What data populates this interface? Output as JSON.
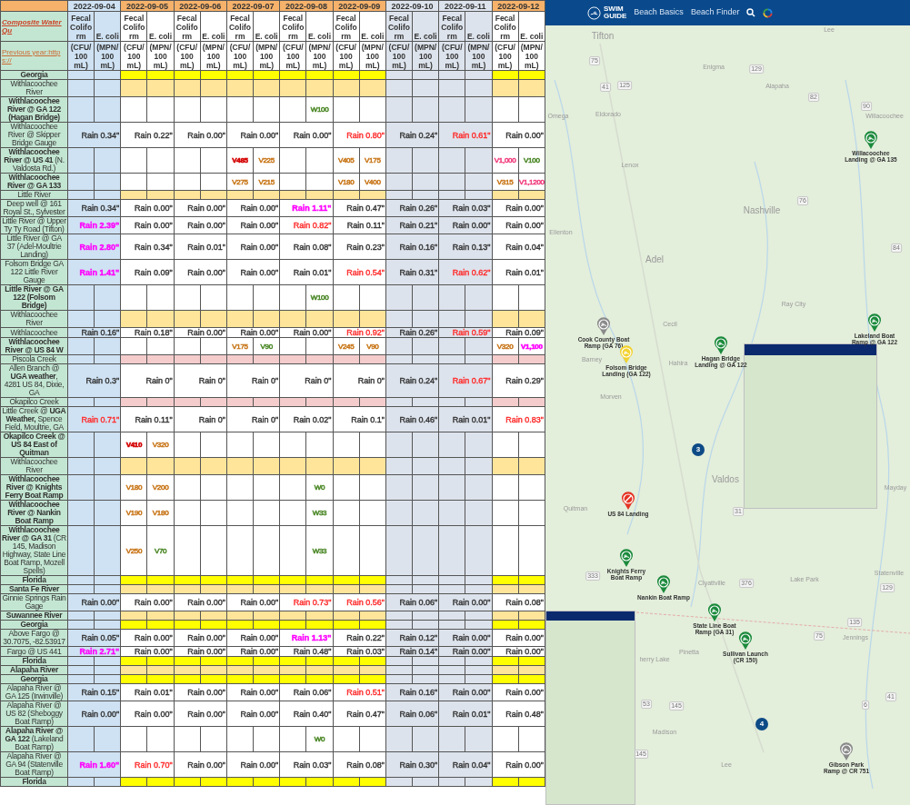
{
  "table": {
    "title": "Composite Water Qu",
    "previous_year": "Previous year:https://",
    "dates": [
      {
        "date": "2022-09-04",
        "kind": "shaded",
        "color": "#cfe2f3",
        "measures": [
          "Fecal Coliform",
          "E. coli"
        ],
        "units": [
          "(CFU/ 100 mL)",
          "(MPN/ 100 mL)"
        ]
      },
      {
        "date": "2022-09-05",
        "kind": "plain",
        "measures": [
          "Fecal Coliform",
          "E. coli"
        ],
        "units": [
          "(CFU/ 100 mL)",
          "(MPN/ 100 mL)"
        ]
      },
      {
        "date": "2022-09-06",
        "kind": "plain",
        "measures": [
          "Fecal Coliform",
          "E. coli"
        ],
        "units": [
          "(CFU/ 100 mL)",
          "(MPN/ 100 mL)"
        ]
      },
      {
        "date": "2022-09-07",
        "kind": "plain",
        "measures": [
          "Fecal Coliform",
          "E. coli"
        ],
        "units": [
          "(CFU/ 100 mL)",
          "(MPN/ 100 mL)"
        ]
      },
      {
        "date": "2022-09-08",
        "kind": "plain",
        "measures": [
          "Fecal Coliform",
          "E. coli"
        ],
        "units": [
          "(CFU/ 100 mL)",
          "(MPN/ 100 mL)"
        ]
      },
      {
        "date": "2022-09-09",
        "kind": "plain",
        "measures": [
          "Fecal Coliform",
          "E. coli"
        ],
        "units": [
          "(CFU/ 100 mL)",
          "(MPN/ 100 mL)"
        ]
      },
      {
        "date": "2022-09-10",
        "kind": "shaded",
        "color": "#dde3ec",
        "measures": [
          "Fecal Coliform",
          "E. coli"
        ],
        "units": [
          "(CFU/ 100 mL)",
          "(MPN/ 100 mL)"
        ]
      },
      {
        "date": "2022-09-11",
        "kind": "shaded",
        "color": "#dde3ec",
        "measures": [
          "Fecal Coliform",
          "E. coli"
        ],
        "units": [
          "(CFU/ 100 mL)",
          "(MPN/ 100 mL)"
        ]
      },
      {
        "date": "2022-09-12",
        "kind": "plain",
        "measures": [
          "Fecal Coliform",
          "E. coli"
        ],
        "units": [
          "(CFU/ 100 mL)",
          "(MPN/ 100 mL)"
        ]
      }
    ],
    "rows": [
      {
        "kind": "state",
        "label": "Georgia",
        "bold": true
      },
      {
        "kind": "river",
        "label": "Withlacoochee River",
        "bold": false
      },
      {
        "kind": "site",
        "label": "Withlacoochee River @ GA 122 (Hagan Bridge)",
        "bold": true,
        "cells": [
          null,
          null,
          null,
          null,
          {
            "ecoli": {
              "text": "W100",
              "color": "#4f8a2b",
              "bold": false
            }
          },
          null,
          null,
          null,
          null
        ]
      },
      {
        "kind": "site",
        "label": "Withlacoochee River @ Skipper Bridge Gauge",
        "bold": false,
        "cells": [
          {
            "rain": "Rain 0.34\"",
            "color": "#333333",
            "bold": false
          },
          {
            "rain": "Rain 0.22\"",
            "color": "#333333",
            "bold": false
          },
          {
            "rain": "Rain 0.00\"",
            "color": "#333333",
            "bold": false
          },
          {
            "rain": "Rain 0.00\"",
            "color": "#333333",
            "bold": false
          },
          {
            "rain": "Rain 0.00\"",
            "color": "#333333",
            "bold": false
          },
          {
            "rain": "Rain 0.80\"",
            "color": "#ff2a2a",
            "bold": false
          },
          {
            "rain": "Rain 0.24\"",
            "color": "#333333",
            "bold": false
          },
          {
            "rain": "Rain 0.61\"",
            "color": "#ff2a2a",
            "bold": false
          },
          {
            "rain": "Rain 0.00\"",
            "color": "#333333",
            "bold": false
          }
        ]
      },
      {
        "kind": "site",
        "label": "**Withlacoochee River @ US 41** (N. Valdosta Rd.)",
        "bold": false,
        "cells": [
          null,
          null,
          null,
          {
            "fecal": {
              "text": "V485",
              "color": "#d40000",
              "bold": true
            },
            "ecoli": {
              "text": "V225",
              "color": "#c9781c",
              "bold": false
            }
          },
          null,
          {
            "fecal": {
              "text": "V405",
              "color": "#c9781c",
              "bold": false
            },
            "ecoli": {
              "text": "V175",
              "color": "#c9781c",
              "bold": false
            }
          },
          null,
          null,
          {
            "fecal": {
              "text": "V1,000",
              "color": "#f0407f",
              "bold": false
            },
            "ecoli": {
              "text": "V100",
              "color": "#4f8a2b",
              "bold": false
            }
          }
        ]
      },
      {
        "kind": "site",
        "label": "Withlacoochee River @ GA 133",
        "bold": true,
        "cells": [
          null,
          null,
          null,
          {
            "fecal": {
              "text": "V275",
              "color": "#c9781c",
              "bold": false
            },
            "ecoli": {
              "text": "V215",
              "color": "#c9781c",
              "bold": false
            }
          },
          null,
          {
            "fecal": {
              "text": "V180",
              "color": "#c9781c",
              "bold": false
            },
            "ecoli": {
              "text": "V400",
              "color": "#c9781c",
              "bold": false
            }
          },
          null,
          null,
          {
            "fecal": {
              "text": "V315",
              "color": "#c9781c",
              "bold": false
            },
            "ecoli": {
              "text": "V1,1200",
              "color": "#f0407f",
              "bold": false
            }
          }
        ]
      },
      {
        "kind": "river",
        "label": "Little River",
        "bold": false
      },
      {
        "kind": "site",
        "label": "Deep well @ 161 Royal St., Sylvester",
        "bold": false,
        "cells": [
          {
            "rain": "Rain 0.34\"",
            "color": "#333333",
            "bold": false
          },
          {
            "rain": "Rain 0.00\"",
            "color": "#333333",
            "bold": false
          },
          {
            "rain": "Rain 0.00\"",
            "color": "#333333",
            "bold": false
          },
          {
            "rain": "Rain 0.00\"",
            "color": "#333333",
            "bold": false
          },
          {
            "rain": "Rain 1.11\"",
            "color": "#ff00ff",
            "bold": true
          },
          {
            "rain": "Rain 0.47\"",
            "color": "#333333",
            "bold": false
          },
          {
            "rain": "Rain 0.26\"",
            "color": "#333333",
            "bold": false
          },
          {
            "rain": "Rain 0.03\"",
            "color": "#333333",
            "bold": false
          },
          {
            "rain": "Rain 0.00\"",
            "color": "#333333",
            "bold": false
          }
        ]
      },
      {
        "kind": "site",
        "label": "Little River @ Upper Ty Ty Road (Tifton)",
        "bold": false,
        "cells": [
          {
            "rain": "Rain 2.39\"",
            "color": "#ff00ff",
            "bold": true
          },
          {
            "rain": "Rain 0.00\"",
            "color": "#333333",
            "bold": false
          },
          {
            "rain": "Rain 0.00\"",
            "color": "#333333",
            "bold": false
          },
          {
            "rain": "Rain 0.00\"",
            "color": "#333333",
            "bold": false
          },
          {
            "rain": "Rain 0.82\"",
            "color": "#ff2a2a",
            "bold": false
          },
          {
            "rain": "Rain 0.11\"",
            "color": "#333333",
            "bold": false
          },
          {
            "rain": "Rain 0.21\"",
            "color": "#333333",
            "bold": false
          },
          {
            "rain": "Rain 0.00\"",
            "color": "#333333",
            "bold": false
          },
          {
            "rain": "Rain 0.00\"",
            "color": "#333333",
            "bold": false
          }
        ]
      },
      {
        "kind": "site",
        "label": "Little River @ GA 37 (Adel-Moultrie Landing)",
        "bold": false,
        "cells": [
          {
            "rain": "Rain 2.80\"",
            "color": "#ff00ff",
            "bold": true
          },
          {
            "rain": "Rain 0.34\"",
            "color": "#333333",
            "bold": false
          },
          {
            "rain": "Rain 0.01\"",
            "color": "#333333",
            "bold": false
          },
          {
            "rain": "Rain 0.00\"",
            "color": "#333333",
            "bold": false
          },
          {
            "rain": "Rain 0.08\"",
            "color": "#333333",
            "bold": false
          },
          {
            "rain": "Rain 0.23\"",
            "color": "#333333",
            "bold": false
          },
          {
            "rain": "Rain 0.16\"",
            "color": "#333333",
            "bold": false
          },
          {
            "rain": "Rain 0.13\"",
            "color": "#333333",
            "bold": false
          },
          {
            "rain": "Rain 0.04\"",
            "color": "#333333",
            "bold": false
          }
        ]
      },
      {
        "kind": "site",
        "label": "Folsom Bridge GA 122 Little River Gauge",
        "bold": false,
        "cells": [
          {
            "rain": "Rain 1.41\"",
            "color": "#ff00ff",
            "bold": true
          },
          {
            "rain": "Rain 0.09\"",
            "color": "#333333",
            "bold": false
          },
          {
            "rain": "Rain 0.00\"",
            "color": "#333333",
            "bold": false
          },
          {
            "rain": "Rain 0.00\"",
            "color": "#333333",
            "bold": false
          },
          {
            "rain": "Rain 0.01\"",
            "color": "#333333",
            "bold": false
          },
          {
            "rain": "Rain 0.54\"",
            "color": "#ff2a2a",
            "bold": false
          },
          {
            "rain": "Rain 0.31\"",
            "color": "#333333",
            "bold": false
          },
          {
            "rain": "Rain 0.62\"",
            "color": "#ff2a2a",
            "bold": false
          },
          {
            "rain": "Rain 0.01\"",
            "color": "#333333",
            "bold": false
          }
        ]
      },
      {
        "kind": "site",
        "label": "Little River @ GA 122 (Folsom Bridge)",
        "bold": true,
        "cells": [
          null,
          null,
          null,
          null,
          {
            "ecoli": {
              "text": "W100",
              "color": "#4f8a2b",
              "bold": false
            }
          },
          null,
          null,
          null,
          null
        ]
      },
      {
        "kind": "river",
        "label": "Withlacoochee River",
        "bold": false
      },
      {
        "kind": "site",
        "label": "Withlacoochee",
        "bold": false,
        "cells": [
          {
            "rain": "Rain 0.16\"",
            "color": "#333333",
            "bold": false
          },
          {
            "rain": "Rain 0.18\"",
            "color": "#333333",
            "bold": false
          },
          {
            "rain": "Rain 0.00\"",
            "color": "#333333",
            "bold": false
          },
          {
            "rain": "Rain 0.00\"",
            "color": "#333333",
            "bold": false
          },
          {
            "rain": "Rain 0.00\"",
            "color": "#333333",
            "bold": false
          },
          {
            "rain": "Rain 0.92\"",
            "color": "#ff2a2a",
            "bold": false
          },
          {
            "rain": "Rain 0.26\"",
            "color": "#333333",
            "bold": false
          },
          {
            "rain": "Rain 0.59\"",
            "color": "#ff2a2a",
            "bold": false
          },
          {
            "rain": "Rain 0.09\"",
            "color": "#333333",
            "bold": false
          }
        ]
      },
      {
        "kind": "site",
        "label": "Withlacoochee River @ US 84 W",
        "bold": true,
        "cells": [
          null,
          null,
          null,
          {
            "fecal": {
              "text": "V175",
              "color": "#c9781c",
              "bold": false
            },
            "ecoli": {
              "text": "V90",
              "color": "#4f8a2b",
              "bold": false
            }
          },
          null,
          {
            "fecal": {
              "text": "V245",
              "color": "#c9781c",
              "bold": false
            },
            "ecoli": {
              "text": "V90",
              "color": "#c9781c",
              "bold": false
            }
          },
          null,
          null,
          {
            "fecal": {
              "text": "V320",
              "color": "#c9781c",
              "bold": false
            },
            "ecoli": {
              "text": "V1,100",
              "color": "#ff00ff",
              "bold": true
            }
          }
        ]
      },
      {
        "kind": "creek",
        "label": "Piscola Creek",
        "bold": false
      },
      {
        "kind": "site",
        "label": "Allen  Branch @ **UGA weather**, 4281 US 84, Dixie, GA",
        "bold": false,
        "cells": [
          {
            "rain": "Rain 0.3\"",
            "color": "#333333",
            "bold": false
          },
          {
            "rain": "Rain 0\"",
            "color": "#333333",
            "bold": false
          },
          {
            "rain": "Rain 0\"",
            "color": "#333333",
            "bold": false
          },
          {
            "rain": "Rain 0\"",
            "color": "#333333",
            "bold": false
          },
          {
            "rain": "Rain 0\"",
            "color": "#333333",
            "bold": false
          },
          {
            "rain": "Rain 0\"",
            "color": "#333333",
            "bold": false
          },
          {
            "rain": "Rain 0.24\"",
            "color": "#333333",
            "bold": false
          },
          {
            "rain": "Rain 0.67\"",
            "color": "#ff2a2a",
            "bold": false
          },
          {
            "rain": "Rain 0.29\"",
            "color": "#333333",
            "bold": false
          }
        ]
      },
      {
        "kind": "creek",
        "label": "Okapilco Creek",
        "bold": false
      },
      {
        "kind": "site",
        "label": "Little Creek @ **UGA Weather,** Spence Field, Moultrie, GA",
        "bold": false,
        "cells": [
          {
            "rain": "Rain 0.71\"",
            "color": "#ff2a2a",
            "bold": false
          },
          {
            "rain": "Rain 0.11\"",
            "color": "#333333",
            "bold": false
          },
          {
            "rain": "Rain 0\"",
            "color": "#333333",
            "bold": false
          },
          {
            "rain": "Rain 0\"",
            "color": "#333333",
            "bold": false
          },
          {
            "rain": "Rain 0.02\"",
            "color": "#333333",
            "bold": false
          },
          {
            "rain": "Rain 0.1\"",
            "color": "#333333",
            "bold": false
          },
          {
            "rain": "Rain 0.46\"",
            "color": "#333333",
            "bold": false
          },
          {
            "rain": "Rain 0.01\"",
            "color": "#333333",
            "bold": false
          },
          {
            "rain": "Rain 0.83\"",
            "color": "#ff2a2a",
            "bold": false
          }
        ]
      },
      {
        "kind": "site",
        "label": "Okapilco Creek @ US 84 East of Quitman",
        "bold": true,
        "cells": [
          null,
          {
            "fecal": {
              "text": "V410",
              "color": "#d40000",
              "bold": true
            },
            "ecoli": {
              "text": "V320",
              "color": "#c9781c",
              "bold": false
            }
          },
          null,
          null,
          null,
          null,
          null,
          null,
          null
        ]
      },
      {
        "kind": "river",
        "label": "Withlacoochee River",
        "bold": false
      },
      {
        "kind": "site",
        "label": "Withlacoochee River @ Knights Ferry Boat Ramp",
        "bold": true,
        "cells": [
          null,
          {
            "fecal": {
              "text": "V180",
              "color": "#c9781c",
              "bold": false
            },
            "ecoli": {
              "text": "V200",
              "color": "#c9781c",
              "bold": false
            }
          },
          null,
          null,
          {
            "ecoli": {
              "text": "W0",
              "color": "#4f8a2b",
              "bold": false
            }
          },
          null,
          null,
          null,
          null
        ]
      },
      {
        "kind": "site",
        "label": "Withlacoochee River @ Nankin Boat Ramp",
        "bold": true,
        "cells": [
          null,
          {
            "fecal": {
              "text": "V190",
              "color": "#c9781c",
              "bold": false
            },
            "ecoli": {
              "text": "V180",
              "color": "#c9781c",
              "bold": false
            }
          },
          null,
          null,
          {
            "ecoli": {
              "text": "W33",
              "color": "#4f8a2b",
              "bold": false
            }
          },
          null,
          null,
          null,
          null
        ]
      },
      {
        "kind": "site",
        "label": "**Withlacoochee River @ GA 31** (CR 145, Madison Highway, State Line Boat Ramp, Mozell Spells)",
        "bold": false,
        "cells": [
          null,
          {
            "fecal": {
              "text": "V250",
              "color": "#c9781c",
              "bold": false
            },
            "ecoli": {
              "text": "V70",
              "color": "#4f8a2b",
              "bold": false
            }
          },
          null,
          null,
          {
            "ecoli": {
              "text": "W33",
              "color": "#4f8a2b",
              "bold": false
            }
          },
          null,
          null,
          null,
          null
        ]
      },
      {
        "kind": "state",
        "label": "Florida",
        "bold": true
      },
      {
        "kind": "river",
        "label": "Santa Fe River",
        "bold": true
      },
      {
        "kind": "site",
        "label": "Ginnie Springs Rain Gage",
        "bold": false,
        "cells": [
          {
            "rain": "Rain 0.00\"",
            "color": "#333333",
            "bold": false
          },
          {
            "rain": "Rain 0.00\"",
            "color": "#333333",
            "bold": false
          },
          {
            "rain": "Rain 0.00\"",
            "color": "#333333",
            "bold": false
          },
          {
            "rain": "Rain 0.00\"",
            "color": "#333333",
            "bold": false
          },
          {
            "rain": "Rain 0.73\"",
            "color": "#ff2a2a",
            "bold": false
          },
          {
            "rain": "Rain 0.56\"",
            "color": "#ff2a2a",
            "bold": false
          },
          {
            "rain": "Rain 0.06\"",
            "color": "#333333",
            "bold": false
          },
          {
            "rain": "Rain 0.00\"",
            "color": "#333333",
            "bold": false
          },
          {
            "rain": "Rain 0.08\"",
            "color": "#333333",
            "bold": false
          }
        ]
      },
      {
        "kind": "river",
        "label": "Suwannee River",
        "bold": true
      },
      {
        "kind": "state",
        "label": "Georgia",
        "bold": true
      },
      {
        "kind": "site",
        "label": "Above Fargo @ 30.7075, -82.53917",
        "bold": false,
        "cells": [
          {
            "rain": "Rain 0.05\"",
            "color": "#333333",
            "bold": false
          },
          {
            "rain": "Rain 0.00\"",
            "color": "#333333",
            "bold": false
          },
          {
            "rain": "Rain 0.00\"",
            "color": "#333333",
            "bold": false
          },
          {
            "rain": "Rain 0.00\"",
            "color": "#333333",
            "bold": false
          },
          {
            "rain": "Rain 1.13\"",
            "color": "#ff00ff",
            "bold": true
          },
          {
            "rain": "Rain 0.22\"",
            "color": "#333333",
            "bold": false
          },
          {
            "rain": "Rain 0.12\"",
            "color": "#333333",
            "bold": false
          },
          {
            "rain": "Rain 0.00\"",
            "color": "#333333",
            "bold": false
          },
          {
            "rain": "Rain 0.00\"",
            "color": "#333333",
            "bold": false
          }
        ]
      },
      {
        "kind": "site",
        "label": "Fargo @ US 441",
        "bold": false,
        "cells": [
          {
            "rain": "Rain 2.71\"",
            "color": "#ff00ff",
            "bold": true
          },
          {
            "rain": "Rain 0.00\"",
            "color": "#333333",
            "bold": false
          },
          {
            "rain": "Rain 0.00\"",
            "color": "#333333",
            "bold": false
          },
          {
            "rain": "Rain 0.00\"",
            "color": "#333333",
            "bold": false
          },
          {
            "rain": "Rain 0.48\"",
            "color": "#333333",
            "bold": false
          },
          {
            "rain": "Rain 0.03\"",
            "color": "#333333",
            "bold": false
          },
          {
            "rain": "Rain 0.14\"",
            "color": "#333333",
            "bold": false
          },
          {
            "rain": "Rain 0.00\"",
            "color": "#333333",
            "bold": false
          },
          {
            "rain": "Rain 0.00\"",
            "color": "#333333",
            "bold": false
          }
        ]
      },
      {
        "kind": "state",
        "label": "Florida",
        "bold": true
      },
      {
        "kind": "river",
        "label": "Alapaha River",
        "bold": true
      },
      {
        "kind": "state",
        "label": "Georgia",
        "bold": true
      },
      {
        "kind": "site",
        "label": "Alapaha River @ GA 125 (Irwinville)",
        "bold": false,
        "cells": [
          {
            "rain": "Rain 0.15\"",
            "color": "#333333",
            "bold": false
          },
          {
            "rain": "Rain 0.01\"",
            "color": "#333333",
            "bold": false
          },
          {
            "rain": "Rain 0.00\"",
            "color": "#333333",
            "bold": false
          },
          {
            "rain": "Rain 0.00\"",
            "color": "#333333",
            "bold": false
          },
          {
            "rain": "Rain 0.06\"",
            "color": "#333333",
            "bold": false
          },
          {
            "rain": "Rain 0.51\"",
            "color": "#ff2a2a",
            "bold": false
          },
          {
            "rain": "Rain 0.16\"",
            "color": "#333333",
            "bold": false
          },
          {
            "rain": "Rain 0.00\"",
            "color": "#333333",
            "bold": false
          },
          {
            "rain": "Rain 0.00\"",
            "color": "#333333",
            "bold": false
          }
        ]
      },
      {
        "kind": "site",
        "label": "Alapaha River @ US 82 (Sheboggy Boat Ramp)",
        "bold": false,
        "cells": [
          {
            "rain": "Rain 0.00\"",
            "color": "#333333",
            "bold": false
          },
          {
            "rain": "Rain 0.00\"",
            "color": "#333333",
            "bold": false
          },
          {
            "rain": "Rain 0.00\"",
            "color": "#333333",
            "bold": false
          },
          {
            "rain": "Rain 0.00\"",
            "color": "#333333",
            "bold": false
          },
          {
            "rain": "Rain 0.40\"",
            "color": "#333333",
            "bold": false
          },
          {
            "rain": "Rain 0.47\"",
            "color": "#333333",
            "bold": false
          },
          {
            "rain": "Rain 0.06\"",
            "color": "#333333",
            "bold": false
          },
          {
            "rain": "Rain 0.01\"",
            "color": "#333333",
            "bold": false
          },
          {
            "rain": "Rain 0.48\"",
            "color": "#333333",
            "bold": false
          }
        ]
      },
      {
        "kind": "site",
        "label": "**Alapaha River @ GA 122** (Lakeland Boat Ramp)",
        "bold": false,
        "cells": [
          null,
          null,
          null,
          null,
          {
            "ecoli": {
              "text": "W0",
              "color": "#4f8a2b",
              "bold": false
            }
          },
          null,
          null,
          null,
          null
        ]
      },
      {
        "kind": "site",
        "label": "Alapaha River @ GA 94 (Statenville Boat Ramp)",
        "bold": false,
        "cells": [
          {
            "rain": "Rain 1.60\"",
            "color": "#ff00ff",
            "bold": true
          },
          {
            "rain": "Rain 0.70\"",
            "color": "#ff2a2a",
            "bold": false
          },
          {
            "rain": "Rain 0.00\"",
            "color": "#333333",
            "bold": false
          },
          {
            "rain": "Rain 0.00\"",
            "color": "#333333",
            "bold": false
          },
          {
            "rain": "Rain 0.03\"",
            "color": "#333333",
            "bold": false
          },
          {
            "rain": "Rain 0.08\"",
            "color": "#333333",
            "bold": false
          },
          {
            "rain": "Rain 0.30\"",
            "color": "#333333",
            "bold": false
          },
          {
            "rain": "Rain 0.04\"",
            "color": "#333333",
            "bold": false
          },
          {
            "rain": "Rain 0.00\"",
            "color": "#333333",
            "bold": false
          }
        ]
      },
      {
        "kind": "state",
        "label": "Florida",
        "bold": true
      }
    ]
  },
  "map": {
    "nav": {
      "logo_lines": [
        "SWIM",
        "GUIDE"
      ],
      "links": [
        "Beach Basics",
        "Beach Finder"
      ]
    },
    "places": [
      {
        "kind": "city",
        "text": "Tifton"
      },
      {
        "kind": "town",
        "text": "Lee"
      },
      {
        "kind": "town",
        "text": "Enigma"
      },
      {
        "kind": "town",
        "text": "Alapaha"
      },
      {
        "kind": "town",
        "text": "Omega"
      },
      {
        "kind": "town",
        "text": "Eldorado"
      },
      {
        "kind": "town",
        "text": "Willacoochee"
      },
      {
        "kind": "town",
        "text": "Lenox"
      },
      {
        "kind": "city",
        "text": "Nashville"
      },
      {
        "kind": "town",
        "text": "Ellenton"
      },
      {
        "kind": "city",
        "text": "Adel"
      },
      {
        "kind": "town",
        "text": "Ray City"
      },
      {
        "kind": "town",
        "text": "Cecil"
      },
      {
        "kind": "town",
        "text": "Barney"
      },
      {
        "kind": "town",
        "text": "Hahira"
      },
      {
        "kind": "town",
        "text": "Morven"
      },
      {
        "kind": "city",
        "text": "Valdos"
      },
      {
        "kind": "town",
        "text": "Quitman"
      },
      {
        "kind": "town",
        "text": "Mayday"
      },
      {
        "kind": "town",
        "text": "Statenville"
      },
      {
        "kind": "town",
        "text": "Lake Park"
      },
      {
        "kind": "town",
        "text": "Clyattville"
      },
      {
        "kind": "town",
        "text": "Jennings"
      },
      {
        "kind": "town",
        "text": "Pinetta"
      },
      {
        "kind": "town",
        "text": "herry Lake"
      },
      {
        "kind": "town",
        "text": "Madison"
      },
      {
        "kind": "town",
        "text": "Lee"
      },
      {
        "kind": "shield",
        "text": "75"
      },
      {
        "kind": "shield",
        "text": "41"
      },
      {
        "kind": "shield",
        "text": "125"
      },
      {
        "kind": "shield",
        "text": "129"
      },
      {
        "kind": "shield",
        "text": "82"
      },
      {
        "kind": "shield",
        "text": "90"
      },
      {
        "kind": "shield",
        "text": "76"
      },
      {
        "kind": "shield",
        "text": "84"
      },
      {
        "kind": "shield",
        "text": "31"
      },
      {
        "kind": "shield",
        "text": "376"
      },
      {
        "kind": "shield",
        "text": "333"
      },
      {
        "kind": "shield",
        "text": "129"
      },
      {
        "kind": "shield",
        "text": "135"
      },
      {
        "kind": "shield",
        "text": "75"
      },
      {
        "kind": "shield",
        "text": "53"
      },
      {
        "kind": "shield",
        "text": "145"
      },
      {
        "kind": "shield",
        "text": "6"
      },
      {
        "kind": "shield",
        "text": "41"
      },
      {
        "kind": "shield",
        "text": "145"
      }
    ],
    "pins": [
      {
        "kind": "beach",
        "label": "Willacoochee Landing @ GA 135",
        "color": "#1b8a3c"
      },
      {
        "kind": "beach",
        "label": "Cook County Boat Ramp (GA 76)",
        "color": "#8a8a8a"
      },
      {
        "kind": "beach",
        "label": "Folsom Bridge Landing (GA 122)",
        "color": "#f2d22e"
      },
      {
        "kind": "beach",
        "label": "Hagan Bridge Landing @ GA 122",
        "color": "#1b8a3c"
      },
      {
        "kind": "beach",
        "label": "Lakeland Boat Ramp @ GA 122",
        "color": "#1b8a3c"
      },
      {
        "kind": "cluster",
        "label": "3",
        "color": "#0d4a86"
      },
      {
        "kind": "closed",
        "label": "US 84 Landing",
        "color": "#e53222"
      },
      {
        "kind": "beach",
        "label": "Knights Ferry Boat Ramp",
        "color": "#1b8a3c"
      },
      {
        "kind": "beach",
        "label": "Nankin Boat Ramp",
        "color": "#1b8a3c"
      },
      {
        "kind": "beach",
        "label": "State Line Boat Ramp (GA 31)",
        "color": "#1b8a3c"
      },
      {
        "kind": "beach",
        "label": "Sullivan Launch (CR 150)",
        "color": "#1b8a3c"
      },
      {
        "kind": "cluster",
        "label": "4",
        "color": "#0d4a86"
      },
      {
        "kind": "beach",
        "label": "Gibson Park Ramp @ CR 751",
        "color": "#8a8a8a"
      }
    ]
  }
}
